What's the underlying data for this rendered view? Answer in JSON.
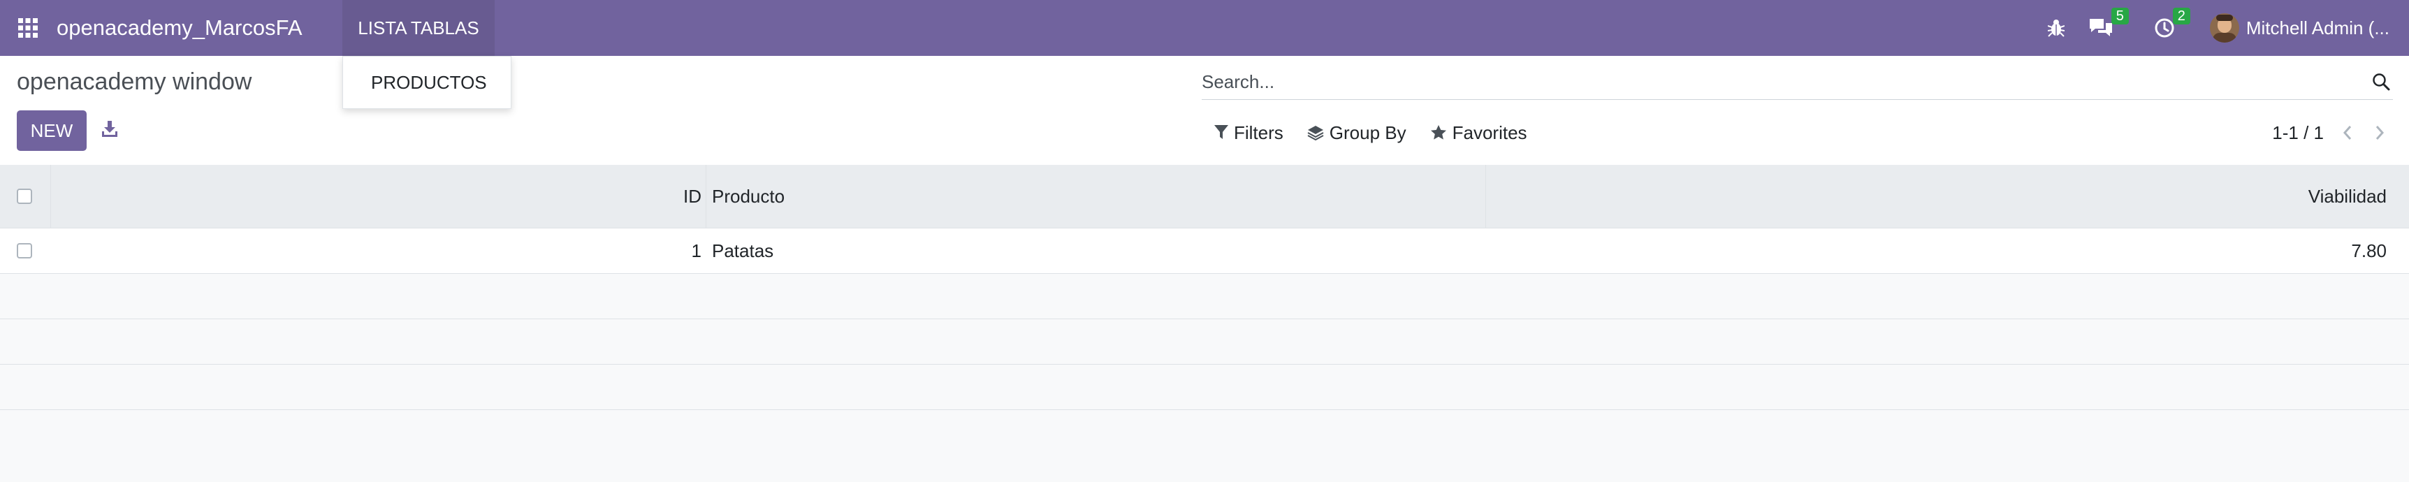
{
  "navbar": {
    "app_title": "openacademy_MarcosFA",
    "menu_label": "LISTA TABLAS",
    "messages_count": "5",
    "activities_count": "2",
    "user_name": "Mitchell Admin (..."
  },
  "dropdown": {
    "items": [
      {
        "label": "PRODUCTOS"
      }
    ]
  },
  "control_panel": {
    "breadcrumb": "openacademy window",
    "new_label": "NEW",
    "search_placeholder": "Search...",
    "filters_label": "Filters",
    "group_by_label": "Group By",
    "favorites_label": "Favorites",
    "pager_value": "1-1 / 1"
  },
  "table": {
    "columns": [
      "ID",
      "Producto",
      "Viabilidad"
    ],
    "rows": [
      {
        "id": "1",
        "producto": "Patatas",
        "viabilidad": "7.80"
      }
    ]
  },
  "colors": {
    "brand": "#71639e",
    "badge": "#28a745",
    "header_bg": "#e9ecef"
  },
  "icons": [
    "apps-grid-icon",
    "bug-icon",
    "chat-icon",
    "clock-icon",
    "download-icon",
    "search-icon",
    "filter-icon",
    "layers-icon",
    "star-icon",
    "chevron-left-icon",
    "chevron-right-icon"
  ]
}
